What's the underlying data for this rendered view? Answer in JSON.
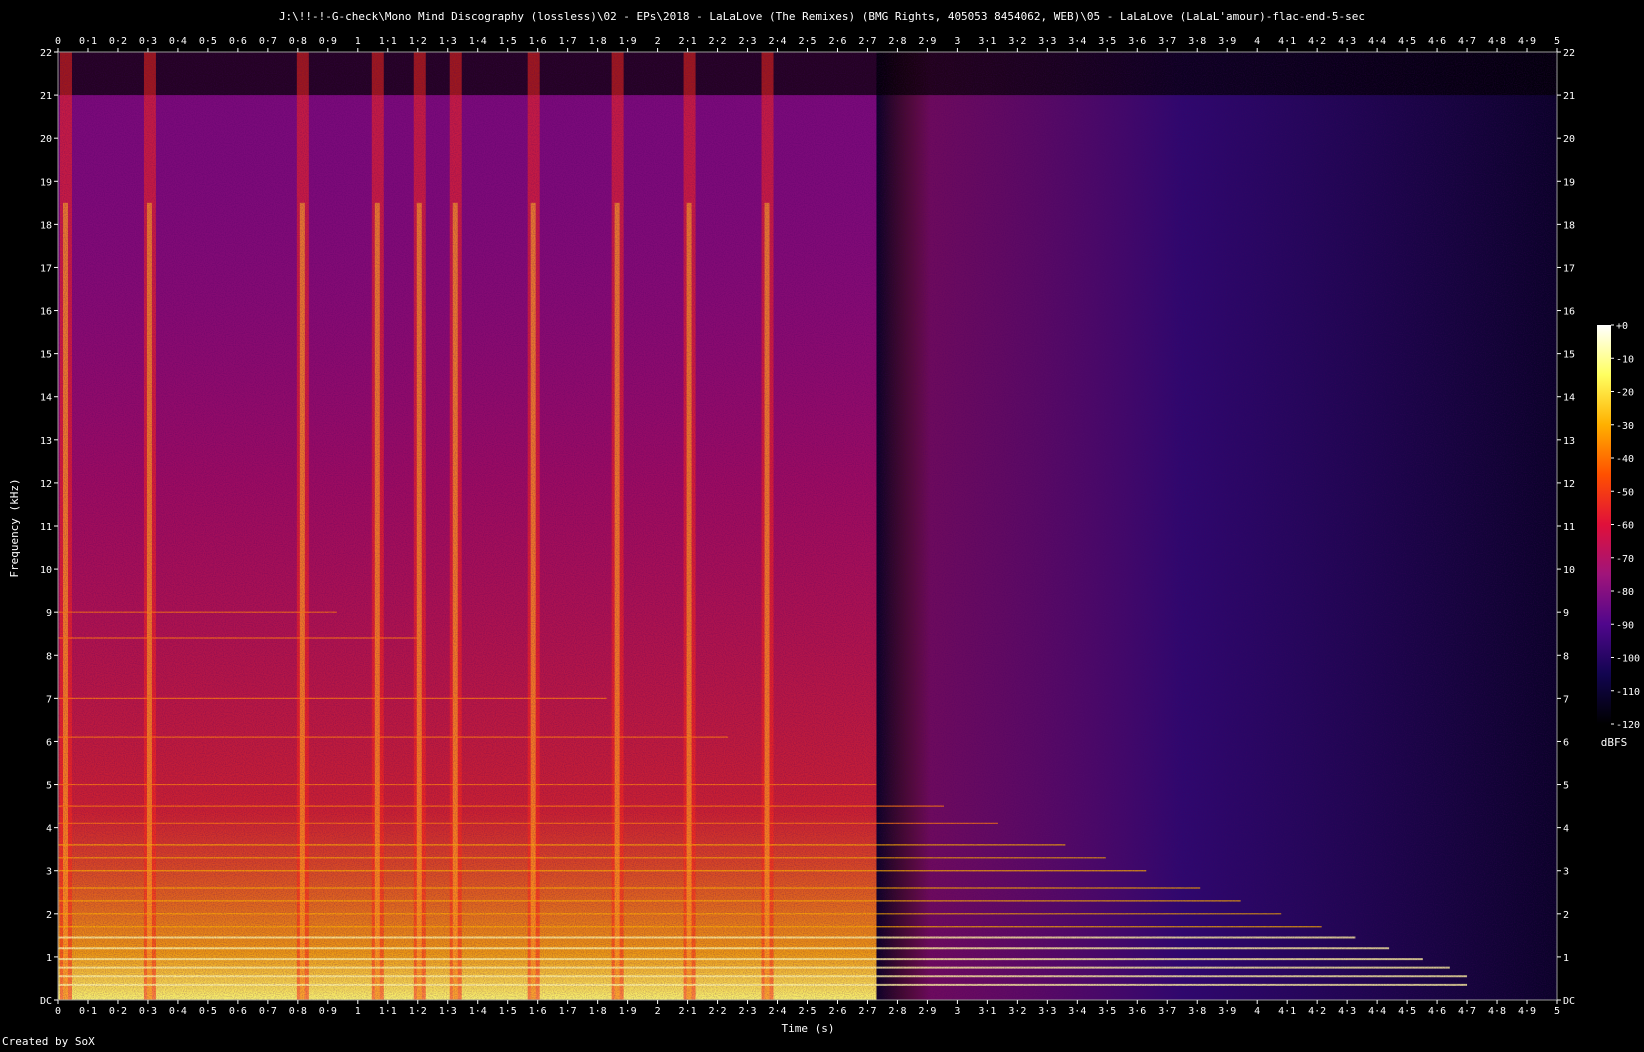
{
  "chart_data": {
    "type": "heatmap",
    "title": "J:\\!!-!-G-check\\Mono Mind Discography (lossless)\\02 - EPs\\2018 - LaLaLove (The Remixes) (BMG Rights, 405053 8454062, WEB)\\05 - LaLaLove (LaLaL'amour)-flac-end-5-sec",
    "xlabel": "Time (s)",
    "ylabel": "Frequency (kHz)",
    "xlim": [
      0,
      5
    ],
    "ylim": [
      0,
      22
    ],
    "x_ticks": [
      "0",
      "0·1",
      "0·2",
      "0·3",
      "0·4",
      "0·5",
      "0·6",
      "0·7",
      "0·8",
      "0·9",
      "1",
      "1·1",
      "1·2",
      "1·3",
      "1·4",
      "1·5",
      "1·6",
      "1·7",
      "1·8",
      "1·9",
      "2",
      "2·1",
      "2·2",
      "2·3",
      "2·4",
      "2·5",
      "2·6",
      "2·7",
      "2·8",
      "2·9",
      "3",
      "3·1",
      "3·2",
      "3·3",
      "3·4",
      "3·5",
      "3·6",
      "3·7",
      "3·8",
      "3·9",
      "4",
      "4·1",
      "4·2",
      "4·3",
      "4·4",
      "4·5",
      "4·6",
      "4·7",
      "4·8",
      "4·9",
      "5"
    ],
    "y_ticks": [
      "DC",
      "1",
      "2",
      "3",
      "4",
      "5",
      "6",
      "7",
      "8",
      "9",
      "10",
      "11",
      "12",
      "13",
      "14",
      "15",
      "16",
      "17",
      "18",
      "19",
      "20",
      "21",
      "22"
    ],
    "colorbar": {
      "label": "dBFS",
      "ticks": [
        "+0",
        "-10",
        "-20",
        "-30",
        "-40",
        "-50",
        "-60",
        "-70",
        "-80",
        "-90",
        "-100",
        "-110",
        "-120"
      ],
      "range": [
        -120,
        0
      ],
      "colors": [
        "#000000",
        "#120550",
        "#50068c",
        "#a0147a",
        "#e0103a",
        "#ff5000",
        "#ffb000",
        "#ffff60",
        "#ffffff"
      ]
    },
    "transients_s": [
      0.02,
      0.3,
      0.81,
      1.06,
      1.2,
      1.32,
      1.58,
      1.86,
      2.1,
      2.36
    ],
    "sustain_end_s": 2.73,
    "fade_end_s": 5.0,
    "partials_khz": [
      0.35,
      0.55,
      0.75,
      0.95,
      1.2,
      1.45,
      1.7,
      2.0,
      2.3,
      2.6,
      3.0,
      3.3,
      3.6,
      4.1,
      4.5,
      5.0,
      6.1,
      7.0,
      8.4,
      9.0
    ],
    "grid": false
  },
  "footer": {
    "credit": "Created by SoX"
  }
}
